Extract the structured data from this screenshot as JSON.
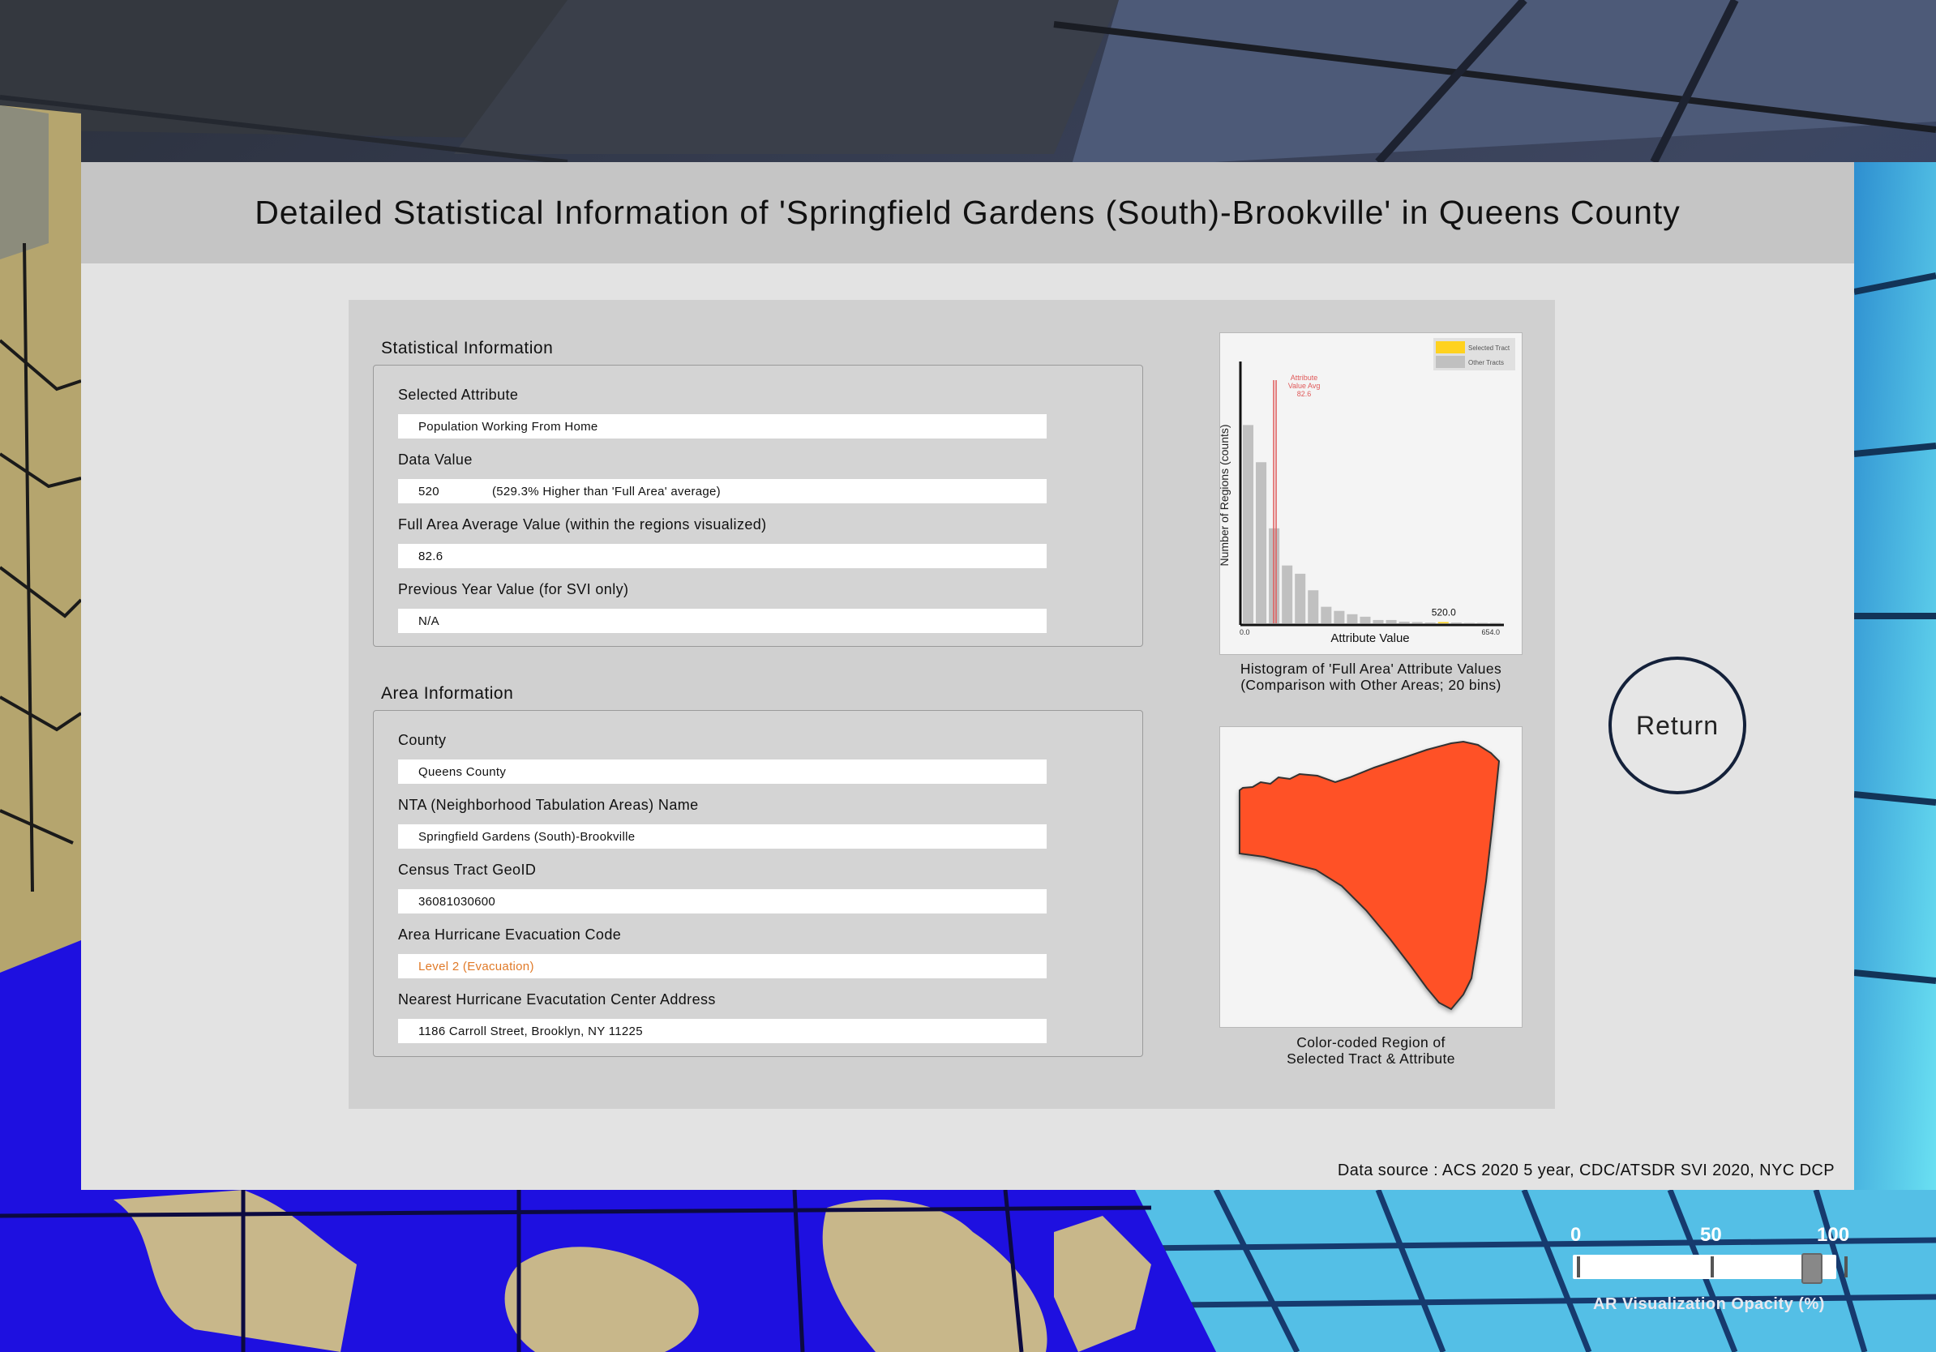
{
  "panel": {
    "title": "Detailed Statistical Information of 'Springfield Gardens (South)-Brookville' in Queens County",
    "data_source": "Data source : ACS 2020 5 year, CDC/ATSDR SVI 2020, NYC DCP"
  },
  "statistical_info": {
    "section_title": "Statistical Information",
    "selected_attribute_label": "Selected Attribute",
    "selected_attribute_value": "Population Working From Home",
    "data_value_label": "Data Value",
    "data_value": "520",
    "data_value_note": "(529.3% Higher than 'Full Area' average)",
    "full_area_avg_label": "Full Area Average Value (within the regions visualized)",
    "full_area_avg_value": "82.6",
    "prev_year_label": "Previous Year Value (for SVI only)",
    "prev_year_value": "N/A"
  },
  "area_info": {
    "section_title": "Area Information",
    "county_label": "County",
    "county_value": "Queens County",
    "nta_label": "NTA (Neighborhood Tabulation Areas) Name",
    "nta_value": "Springfield Gardens (South)-Brookville",
    "geoid_label": "Census Tract GeoID",
    "geoid_value": "36081030600",
    "evac_code_label": "Area Hurricane Evacuation Code",
    "evac_code_value": "Level 2 (Evacuation)",
    "evac_center_label": "Nearest Hurricane Evacutation Center Address",
    "evac_center_value": "1186 Carroll Street, Brooklyn, NY 11225"
  },
  "histogram_caption_line1": "Histogram of 'Full Area' Attribute Values",
  "histogram_caption_line2": "(Comparison with Other Areas; 20 bins)",
  "region_caption_line1": "Color-coded Region of",
  "region_caption_line2": "Selected Tract & Attribute",
  "return_label": "Return",
  "colors": {
    "selected": "#ffd21f",
    "other": "#c0c0c0",
    "avg_line": "#e05a5a",
    "region_fill": "#ff5127",
    "evac_text": "#e07a28"
  },
  "chart_data": {
    "type": "bar",
    "xlabel": "Attribute Value",
    "ylabel": "Number of Regions (counts)",
    "xlim": [
      0.0,
      654.0
    ],
    "x_tick_labels": [
      "0.0",
      "654.0"
    ],
    "bins": 20,
    "values": [
      48,
      39,
      23,
      14,
      12,
      8,
      4,
      3,
      2.2,
      1.6,
      0.8,
      0.8,
      0.4,
      0.3,
      0.2,
      0.3,
      0.2,
      0.1,
      0.1,
      0.1
    ],
    "selected_bin": 15,
    "selected_value_label": "520.0",
    "avg_line_value": 82.6,
    "avg_label_lines": [
      "Attribute",
      "Value Avg",
      "82.6"
    ],
    "legend": [
      {
        "name": "Selected Tract"
      },
      {
        "name": "Other Tracts"
      }
    ],
    "legend_position": "top-right"
  },
  "opacity_slider": {
    "caption": "AR Visualization Opacity (%)",
    "ticks": [
      "0",
      "50",
      "100"
    ],
    "value": 88
  }
}
